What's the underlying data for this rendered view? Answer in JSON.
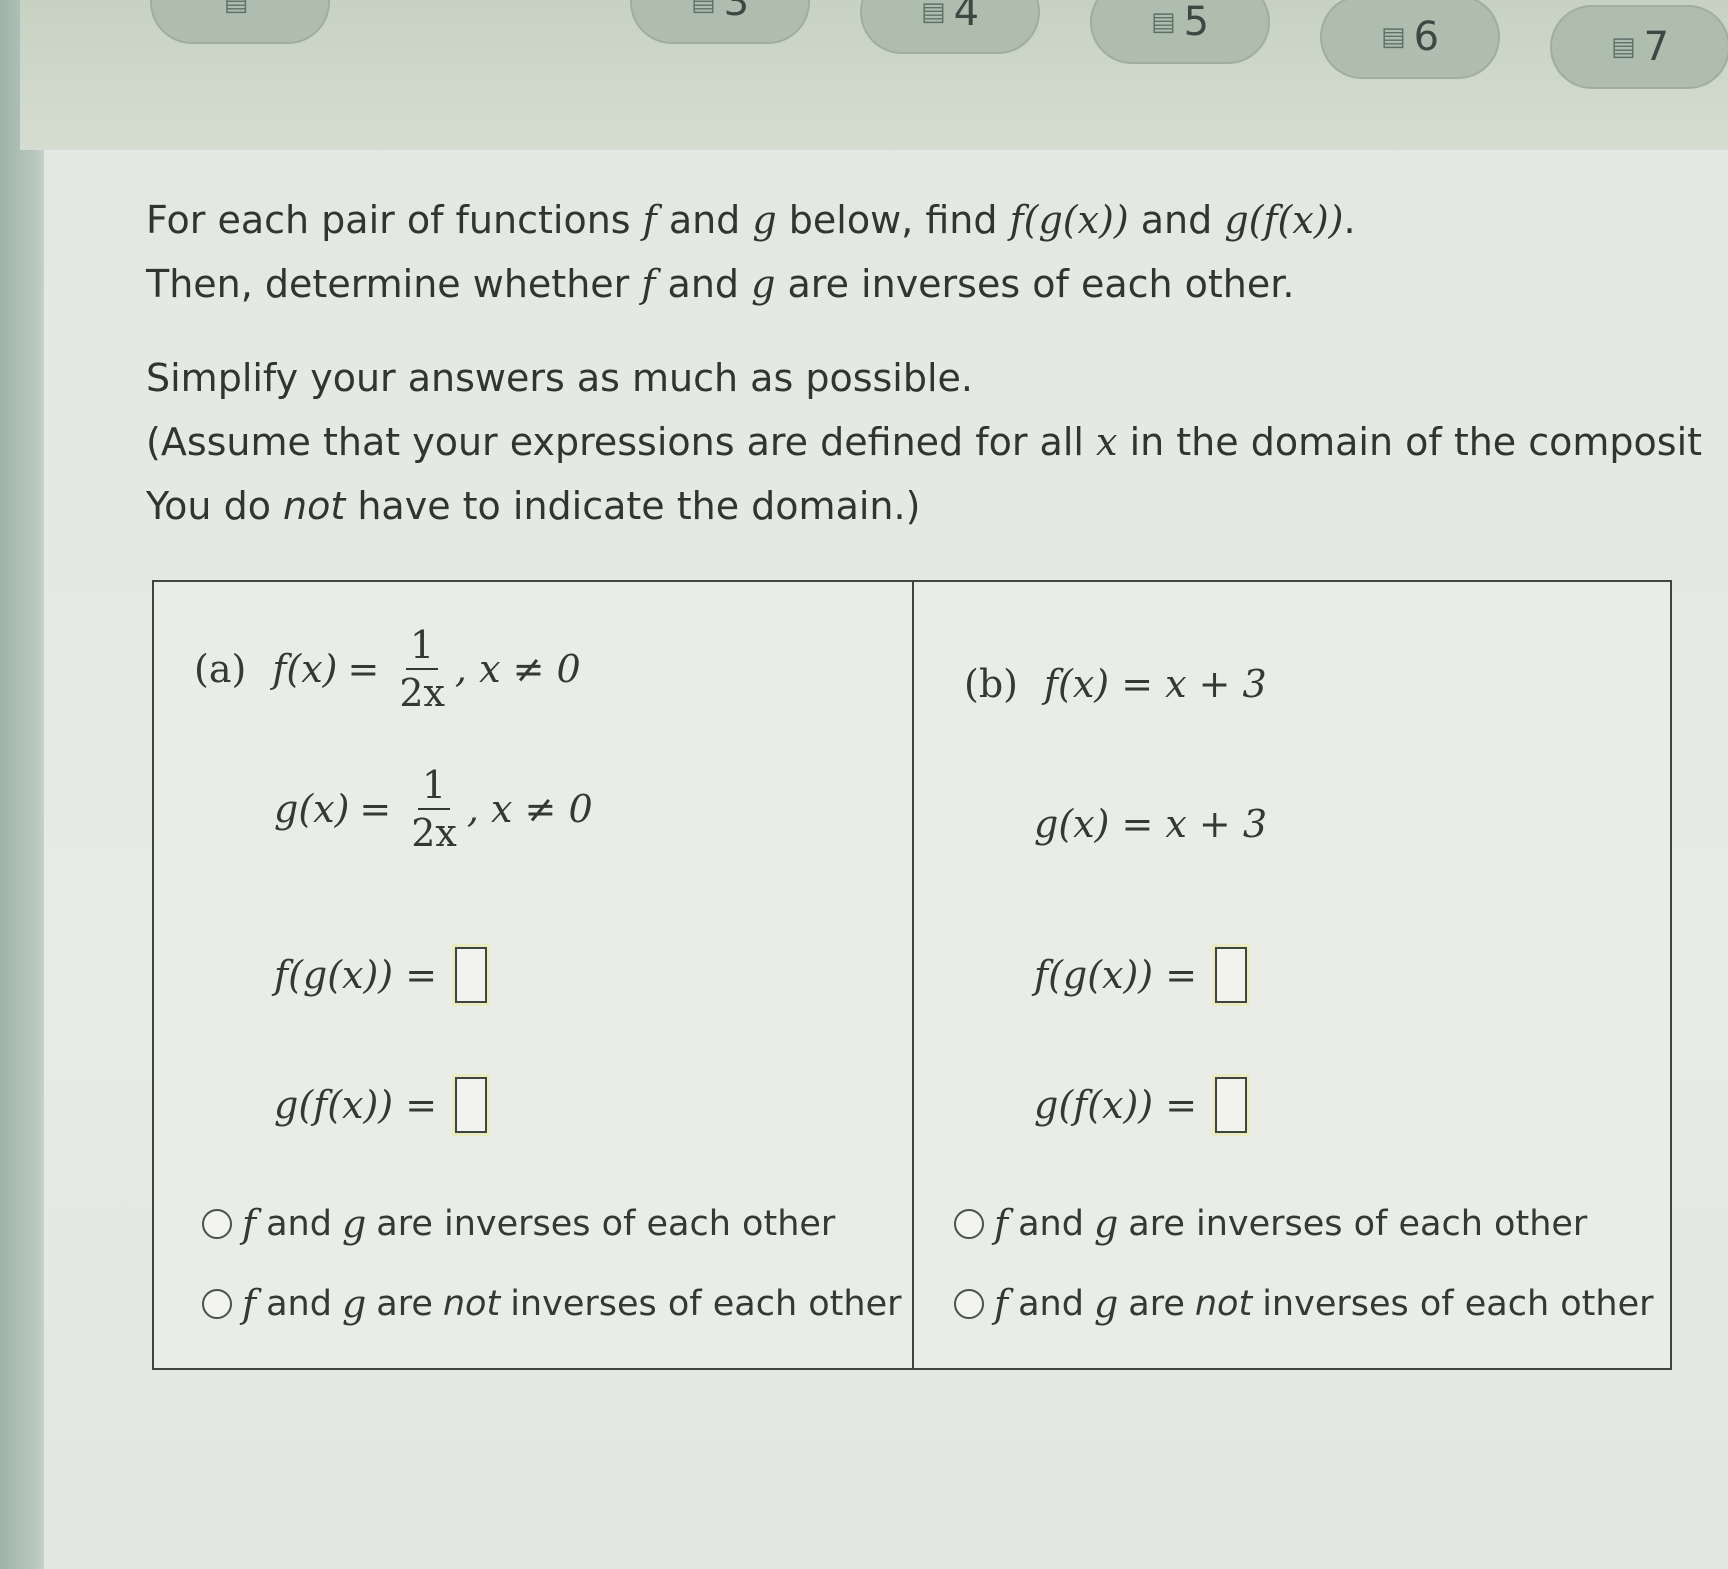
{
  "nav": {
    "tabs": [
      {
        "label": "",
        "icon": "pages-icon"
      },
      {
        "label": "3",
        "icon": "pages-icon"
      },
      {
        "label": "4",
        "icon": "pages-icon"
      },
      {
        "label": "5",
        "icon": "pages-icon"
      },
      {
        "label": "6",
        "icon": "pages-icon"
      },
      {
        "label": "7",
        "icon": "pages-icon"
      }
    ]
  },
  "instructions": {
    "line1_pre": "For each pair of functions ",
    "f": "f",
    "and1": " and ",
    "g": "g",
    "line1_mid": " below, find ",
    "fg": "f(g(x))",
    "and2": " and ",
    "gf": "g(f(x))",
    "period": ".",
    "line2_pre": "Then, determine whether ",
    "line2_and": " and ",
    "line2_post": " are inverses of each other.",
    "line3": "Simplify your answers as much as possible.",
    "line4_pre": "(Assume that your expressions are defined for all ",
    "x": "x",
    "line4_post": " in the domain of the composit",
    "line5_pre": "You do ",
    "line5_not": "not",
    "line5_post": " have to indicate the domain.)"
  },
  "part_a": {
    "label": "(a)",
    "f_lhs": "f(x)",
    "eq": "=",
    "f_num": "1",
    "f_den": "2x",
    "f_cond": ", x ≠ 0",
    "g_lhs": "g(x)",
    "g_num": "1",
    "g_den": "2x",
    "g_cond": ", x ≠ 0",
    "fg_lhs": "f(g(x)) =",
    "gf_lhs": "g(f(x)) =",
    "option1_f": "f",
    "option1_and": "and",
    "option1_g": "g",
    "option1_text": "are inverses of each other",
    "option2_f": "f",
    "option2_and": "and",
    "option2_g": "g",
    "option2_are": "are",
    "option2_not": "not",
    "option2_text": "inverses of each other"
  },
  "part_b": {
    "label": "(b)",
    "f_def": "f(x) = x + 3",
    "g_def": "g(x) = x + 3",
    "fg_lhs": "f(g(x)) =",
    "gf_lhs": "g(f(x)) =",
    "option1_f": "f",
    "option1_and": "and",
    "option1_g": "g",
    "option1_text": "are inverses of each other",
    "option2_f": "f",
    "option2_and": "and",
    "option2_g": "g",
    "option2_are": "are",
    "option2_not": "not",
    "option2_text": "inverses of each other"
  }
}
